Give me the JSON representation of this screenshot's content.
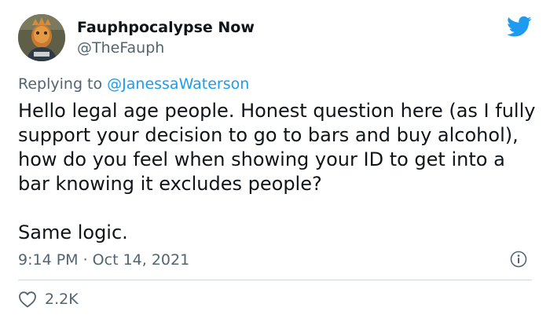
{
  "tweet": {
    "author_name": "Fauphpocalypse Now",
    "author_handle": "@TheFauph",
    "reply_prefix": "Replying to ",
    "reply_to": "@JanessaWaterson",
    "body_paragraphs": [
      "Hello legal age people. Honest question here (as I fully support your decision to go to bars and buy alcohol), how do you feel when showing your ID to get into a bar knowing it excludes people?",
      "Same logic."
    ],
    "timestamp": "9:14 PM · Oct 14, 2021",
    "like_count": "2.2K"
  },
  "icons": {
    "brand": "twitter-bird-icon",
    "info": "info-icon",
    "like": "heart-icon"
  },
  "colors": {
    "brand_blue": "#1d9bf0",
    "text_primary": "#0f1419",
    "text_secondary": "#536471",
    "divider": "#cfd9de"
  }
}
